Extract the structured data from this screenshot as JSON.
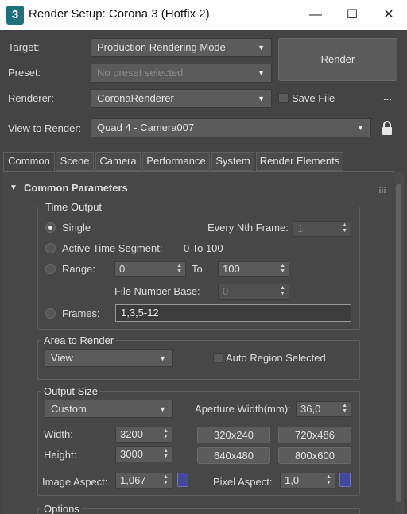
{
  "window": {
    "app_icon_text": "3",
    "title": "Render Setup: Corona 3 (Hotfix 2)",
    "minimize_glyph": "—",
    "maximize_glyph": "☐",
    "close_glyph": "✕"
  },
  "setup": {
    "target_label": "Target:",
    "target_value": "Production Rendering Mode",
    "preset_label": "Preset:",
    "preset_value": "No preset selected",
    "renderer_label": "Renderer:",
    "renderer_value": "CoronaRenderer",
    "save_file_label": "Save File",
    "more_label": "...",
    "view_label": "View to Render:",
    "view_value": "Quad 4 - Camera007",
    "render_button": "Render"
  },
  "tabs": [
    {
      "label": "Common",
      "active": true
    },
    {
      "label": "Scene"
    },
    {
      "label": "Camera"
    },
    {
      "label": "Performance"
    },
    {
      "label": "System"
    },
    {
      "label": "Render Elements"
    }
  ],
  "rollout": {
    "title": "Common Parameters",
    "collapse_glyph": "▼"
  },
  "time_output": {
    "title": "Time Output",
    "single_label": "Single",
    "every_nth_label": "Every Nth Frame:",
    "every_nth_value": "1",
    "active_segment_label": "Active Time Segment:",
    "active_segment_value": "0 To 100",
    "range_label": "Range:",
    "range_from": "0",
    "range_to_label": "To",
    "range_to": "100",
    "file_number_base_label": "File Number Base:",
    "file_number_base_value": "0",
    "frames_label": "Frames:",
    "frames_value": "1,3,5-12"
  },
  "area": {
    "title": "Area to Render",
    "mode_value": "View",
    "auto_region_label": "Auto Region Selected"
  },
  "output_size": {
    "title": "Output Size",
    "preset_value": "Custom",
    "aperture_label": "Aperture Width(mm):",
    "aperture_value": "36,0",
    "width_label": "Width:",
    "width_value": "3200",
    "height_label": "Height:",
    "height_value": "3000",
    "presets": [
      "320x240",
      "720x486",
      "640x480",
      "800x600"
    ],
    "image_aspect_label": "Image Aspect:",
    "image_aspect_value": "1,067",
    "pixel_aspect_label": "Pixel Aspect:",
    "pixel_aspect_value": "1,0"
  },
  "options": {
    "title": "Options"
  }
}
